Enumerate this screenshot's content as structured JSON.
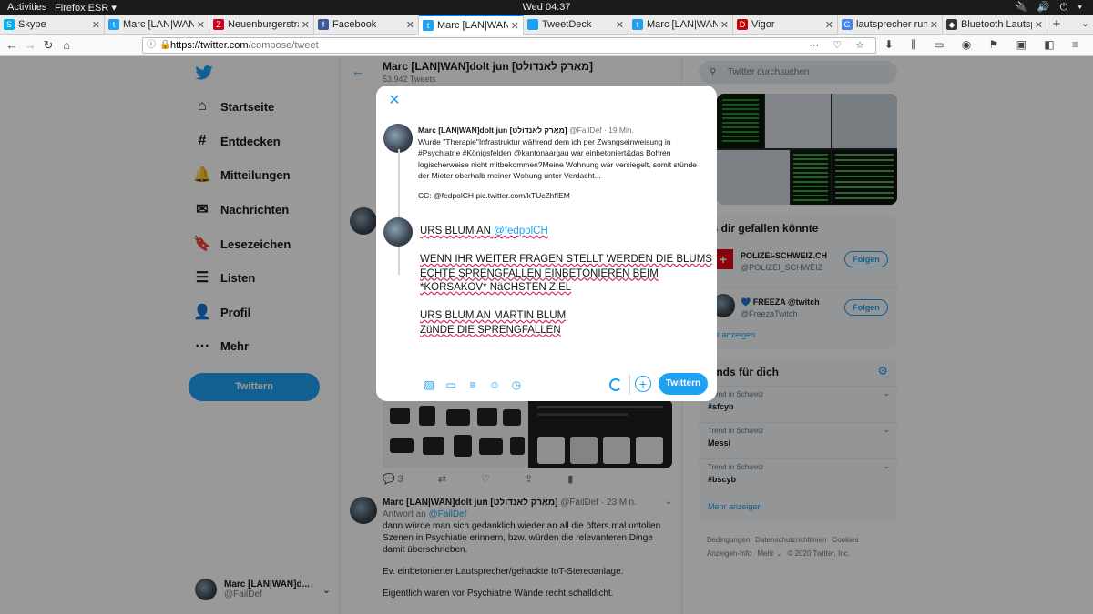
{
  "gnome": {
    "activities": "Activities",
    "app": "Firefox ESR ▾",
    "clock": "Wed 04:37",
    "tray": "🔌 🔊 ⏻ ▾"
  },
  "tabs": [
    {
      "title": "Skype",
      "icon": "skype-icon",
      "color": "#00aff0",
      "glyph": "S"
    },
    {
      "title": "Marc [LAN|WAN]dolt jun",
      "icon": "twitter-icon",
      "color": "#1da1f2",
      "glyph": "t"
    },
    {
      "title": "Neuenburgerstrasse",
      "icon": "zoom-icon",
      "color": "#d0021b",
      "glyph": "Z"
    },
    {
      "title": "Facebook",
      "icon": "facebook-icon",
      "color": "#3b5998",
      "glyph": "f"
    },
    {
      "title": "Marc [LAN|WAN]dolt jun",
      "icon": "twitter-icon",
      "color": "#1da1f2",
      "glyph": "t"
    },
    {
      "title": "TweetDeck",
      "icon": "tweetdeck-icon",
      "color": "#1da1f2",
      "glyph": ""
    },
    {
      "title": "Marc [LAN|WAN]dolt jun",
      "icon": "twitter-icon",
      "color": "#1da1f2",
      "glyph": "t"
    },
    {
      "title": "Vigor",
      "icon": "vigor-icon",
      "color": "#cc0000",
      "glyph": "D"
    },
    {
      "title": "lautsprecher rund",
      "icon": "google-icon",
      "color": "#4285f4",
      "glyph": "G"
    },
    {
      "title": "Bluetooth Lautspr...",
      "icon": "amazon-icon",
      "color": "#333333",
      "glyph": "◆"
    }
  ],
  "url": {
    "host": "https://twitter.com",
    "path": "/compose/tweet"
  },
  "sidebar": {
    "items": [
      {
        "label": "Startseite",
        "icon": "home-icon",
        "glyph": "⌂"
      },
      {
        "label": "Entdecken",
        "icon": "hashtag-icon",
        "glyph": "#"
      },
      {
        "label": "Mitteilungen",
        "icon": "bell-icon",
        "glyph": "🔔"
      },
      {
        "label": "Nachrichten",
        "icon": "mail-icon",
        "glyph": "✉"
      },
      {
        "label": "Lesezeichen",
        "icon": "bookmark-icon",
        "glyph": "🔖"
      },
      {
        "label": "Listen",
        "icon": "list-icon",
        "glyph": "☰"
      },
      {
        "label": "Profil",
        "icon": "person-icon",
        "glyph": "👤"
      },
      {
        "label": "Mehr",
        "icon": "more-icon",
        "glyph": "⋯"
      }
    ],
    "tweet_button": "Twittern",
    "account_name": "Marc [LAN|WAN]d...",
    "account_handle": "@FailDef"
  },
  "timeline": {
    "title": "Marc [LAN|WAN]dolt jun [מאַרק לאנדולט]",
    "count": "53.942 Tweets",
    "actions": {
      "reply_count": "3"
    },
    "tweet2": {
      "name": "Marc [LAN|WAN]dolt jun [מאַרק לאנדולט]",
      "handle": "@FailDef · 23 Min.",
      "reply_prefix": "Antwort an",
      "reply_handle": "@FailDef",
      "p1": "dann würde man sich gedanklich wieder an all die öfters mal untollen Szenen in Psychiatie erinnern, bzw. würden die relevanteren Dinge damit überschrieben.",
      "p2": "Ev. einbetonierter Lautsprecher/gehackte IoT-Stereoanlage.",
      "p3": "Eigentlich waren vor Psychiatrie Wände recht schalldicht."
    }
  },
  "right": {
    "search_placeholder": "Twitter durchsuchen",
    "wtf_title": "as dir gefallen könnte",
    "wtf": [
      {
        "name": "POLIZEI-SCHWEIZ.CH",
        "handle": "@POLIZEI_SCHWEIZ",
        "follow": "Folgen"
      },
      {
        "name": "💙 FREEZA @twitch",
        "handle": "@FreezaTwitch",
        "follow": "Folgen"
      }
    ],
    "more": "ehr anzeigen",
    "trends_title": "rends für dich",
    "trends": [
      {
        "context": "Trend in Schweiz",
        "name": "#sfcyb"
      },
      {
        "context": "Trend in Schweiz",
        "name": "Messi"
      },
      {
        "context": "Trend in Schweiz",
        "name": "#bscyb"
      }
    ],
    "trends_more": "Mehr anzeigen",
    "footer": [
      "Bedingungen",
      "Datenschutzrichtlinien",
      "Cookies",
      "Anzeigen-Info",
      "Mehr ⌄",
      "© 2020 Twitter, Inc."
    ]
  },
  "modal": {
    "quoted": {
      "name": "Marc [LAN|WAN]dolt jun [מאַרק לאנדולט]",
      "handle": "@FailDef · 19 Min.",
      "text": "Wurde \"Therapie\"Infrastruktur während dem ich per Zwangseinweisung in #Psychiatrie #Königsfelden @kantonaargau war einbetoniert&das Bohren logischerweise nicht mitbekommen?Meine Wohnung war versiegelt, somit stünde der Mieter oberhalb meiner Wohung unter Verdacht...",
      "cc": "CC: @fedpolCH pic.twitter.com/kTUcZhfIEM"
    },
    "compose": {
      "l1a": "URS BLUM AN ",
      "l1b": "@fedpolCH",
      "l2": "WENN IHR WEITER FRAGEN STELLT WERDEN DIE BLUMS",
      "l3": "ECHTE SPRENGFALLEN EINBETONIEREN BEIM",
      "l4": "*KORSAKOV* NäCHSTEN ZIEL",
      "l5": "URS BLUM AN MARTIN BLUM",
      "l6": "ZüNDE DIE SPRENGFALLEN"
    },
    "send": "Twittern"
  }
}
